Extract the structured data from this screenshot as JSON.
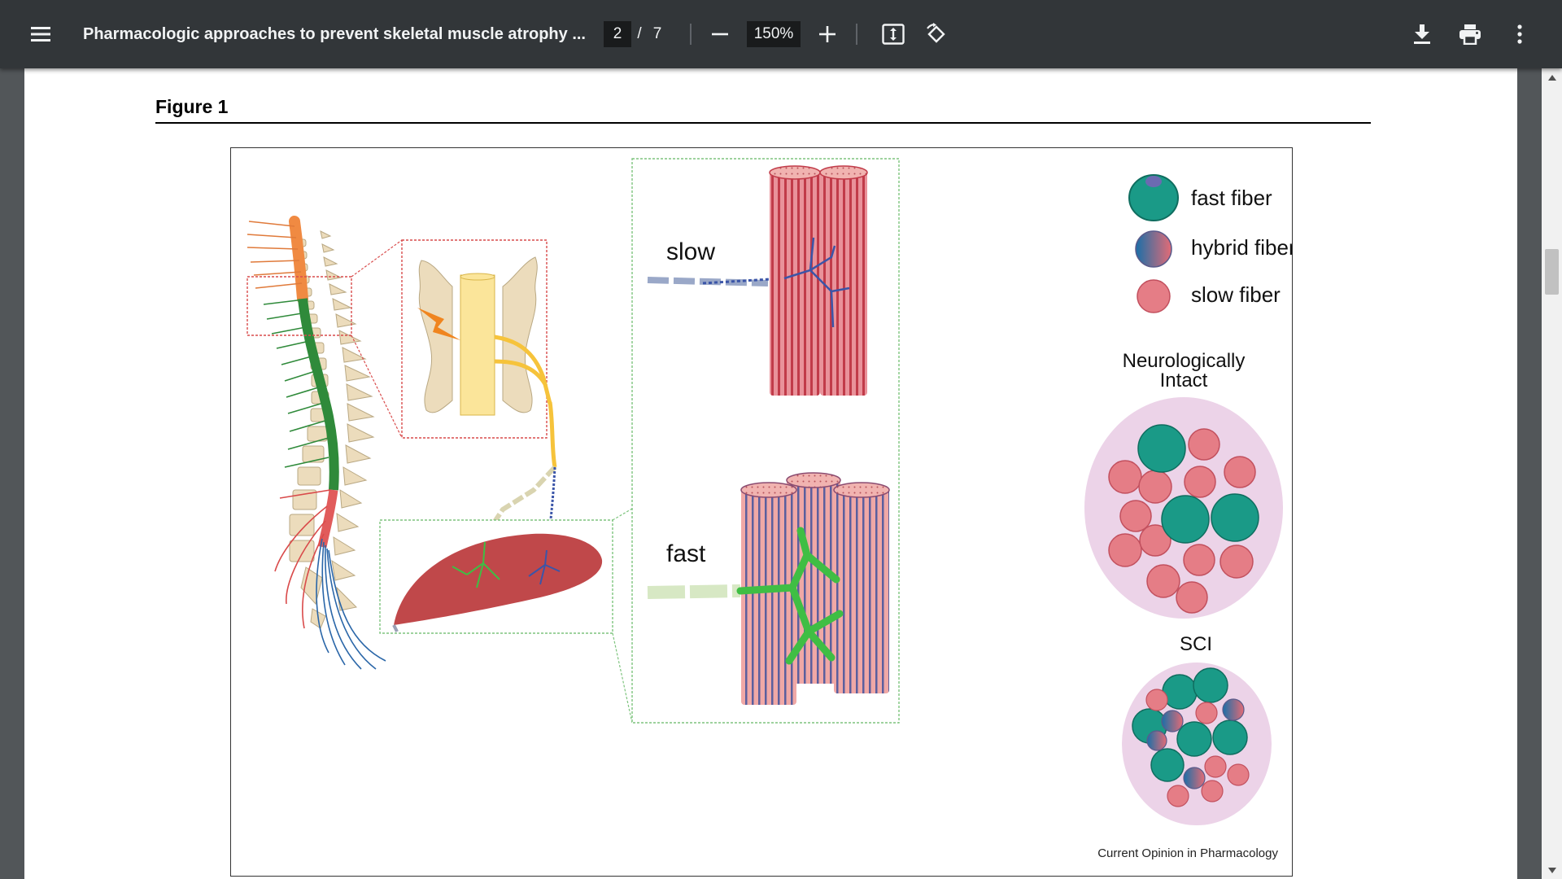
{
  "toolbar": {
    "menu_icon": "hamburger-menu-icon",
    "title": "Pharmacologic approaches to prevent skeletal muscle atrophy ...",
    "current_page": "2",
    "page_separator": "/",
    "total_pages": "7",
    "zoom": "150%",
    "zoom_out_icon": "minus-icon",
    "zoom_in_icon": "plus-icon",
    "fit_icon": "fit-to-page-icon",
    "rotate_icon": "rotate-counterclockwise-icon",
    "download_icon": "download-icon",
    "print_icon": "print-icon",
    "more_icon": "more-vertical-icon",
    "colors": {
      "bar": "#323639",
      "text": "#f1f3f4",
      "field": "#191b1c"
    }
  },
  "document": {
    "figure_heading": "Figure 1",
    "figure": {
      "label_slow": "slow",
      "label_fast": "fast",
      "legend": {
        "fast": "fast fiber",
        "hybrid": "hybrid fiber",
        "slow": "slow fiber"
      },
      "group_intact_line1": "Neurologically",
      "group_intact_line2": "Intact",
      "group_sci": "SCI",
      "credit": "Current Opinion in Pharmacology",
      "colors": {
        "fast_fiber": "#1a9a87",
        "slow_fiber": "#e57d86",
        "cross_section_bg": "#ecd3e8",
        "motor_neuron_fast": "#3fbe44",
        "motor_neuron_slow": "#3b55a8",
        "nerve_yellow": "#f6c33b",
        "muscle": "#c0484a",
        "zoom_box_red": "#d94c4c",
        "zoom_box_green": "#7ec47e"
      }
    }
  },
  "scrollbar": {
    "up_icon": "scroll-up-arrow-icon",
    "down_icon": "scroll-down-arrow-icon"
  }
}
